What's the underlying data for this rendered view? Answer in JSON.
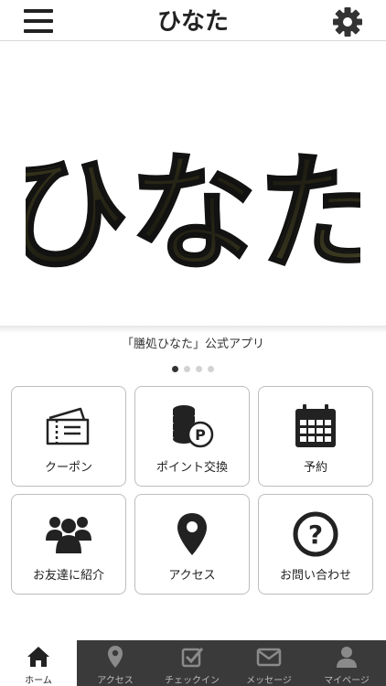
{
  "header": {
    "logo_text": "ひなた",
    "menu_icon": "hamburger-icon",
    "settings_icon": "gear-icon"
  },
  "hero": {
    "logo_text": "ひなた",
    "caption": "「膳処ひなた」公式アプリ",
    "slides_total": 4,
    "active_slide": 1
  },
  "menu": [
    {
      "label": "クーポン",
      "icon": "ticket-icon"
    },
    {
      "label": "ポイント交換",
      "icon": "coins-point-icon"
    },
    {
      "label": "予約",
      "icon": "calendar-icon"
    },
    {
      "label": "お友達に紹介",
      "icon": "people-icon"
    },
    {
      "label": "アクセス",
      "icon": "map-pin-icon"
    },
    {
      "label": "お問い合わせ",
      "icon": "question-circle-icon"
    }
  ],
  "bottom_nav": [
    {
      "label": "ホーム",
      "icon": "home-icon",
      "active": true
    },
    {
      "label": "アクセス",
      "icon": "map-pin-icon",
      "active": false
    },
    {
      "label": "チェックイン",
      "icon": "checkbox-icon",
      "active": false
    },
    {
      "label": "メッセージ",
      "icon": "envelope-icon",
      "active": false
    },
    {
      "label": "マイページ",
      "icon": "user-icon",
      "active": false
    }
  ],
  "colors": {
    "nav_background": "#3a3a3a",
    "icon_dark": "#222222",
    "border": "#bdbdbd"
  }
}
